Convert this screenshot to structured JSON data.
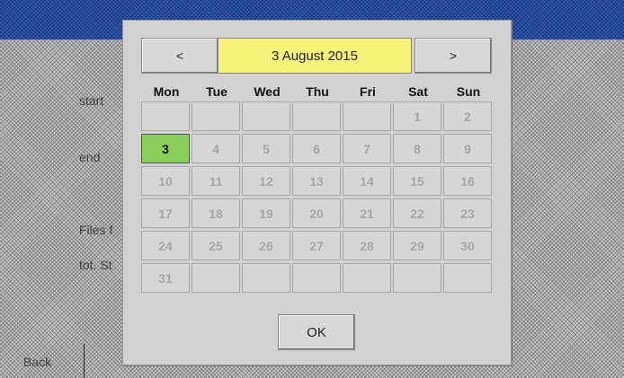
{
  "background": {
    "labels": {
      "start": "start",
      "end": "end",
      "files": "Files f",
      "tot": "tot. St",
      "back": "Back"
    }
  },
  "calendar": {
    "prev_label": "<",
    "next_label": ">",
    "current_date": "3 August 2015",
    "weekdays": [
      "Mon",
      "Tue",
      "Wed",
      "Thu",
      "Fri",
      "Sat",
      "Sun"
    ],
    "days": [
      "",
      "",
      "",
      "",
      "",
      "1",
      "2",
      "3",
      "4",
      "5",
      "6",
      "7",
      "8",
      "9",
      "10",
      "11",
      "12",
      "13",
      "14",
      "15",
      "16",
      "17",
      "18",
      "19",
      "20",
      "21",
      "22",
      "23",
      "24",
      "25",
      "26",
      "27",
      "28",
      "29",
      "30",
      "31",
      "",
      "",
      "",
      "",
      "",
      ""
    ],
    "selected_day": "3",
    "ok_label": "OK"
  },
  "colors": {
    "date_field": "#f7f37a",
    "selected_day": "#8cce5c"
  }
}
